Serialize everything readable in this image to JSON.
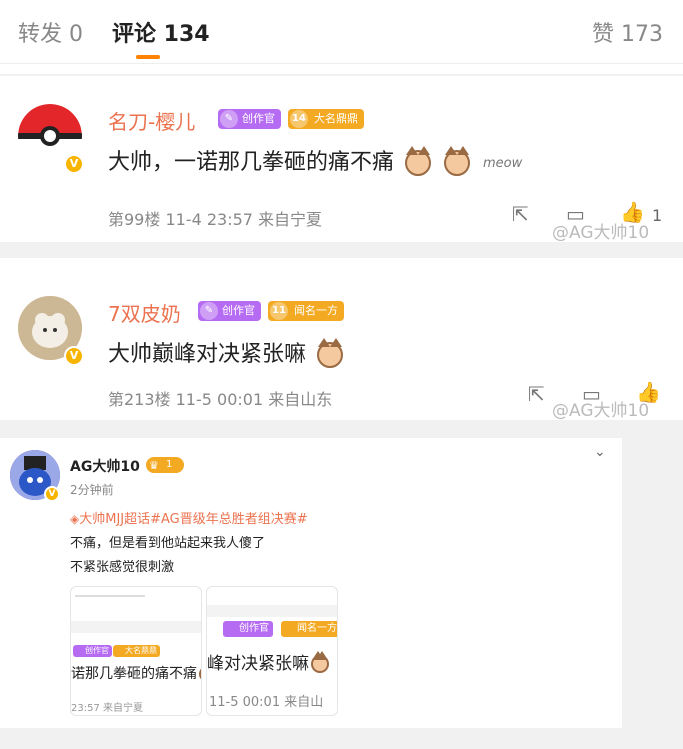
{
  "tabs": {
    "repost": "转发 0",
    "comment": "评论 134",
    "like": "赞 173"
  },
  "comment1": {
    "username": "名刀-樱儿",
    "chip_creator": "创作官",
    "chip_level": "14",
    "chip_title": "大名鼎鼎",
    "text": "大帅，一诺那几拳砸的痛不痛",
    "sticker": "meow",
    "meta": "第99楼 11-4 23:57 来自宁夏",
    "like_count": "1",
    "watermark": "@AG大帅10"
  },
  "comment2": {
    "username": "7双皮奶",
    "chip_creator": "创作官",
    "chip_level": "11",
    "chip_title": "闻名一方",
    "text": "大帅巅峰对决紧张嘛",
    "meta": "第213楼 11-5 00:01 来自山东",
    "watermark": "@AG大帅10"
  },
  "post": {
    "username": "AG大帅10",
    "level_badge": "1",
    "time": "2分钟前",
    "topics": "大帅MJJ超话#AG晋级年总胜者组决赛#",
    "line1": "不痛，但是看到他站起来我人傻了",
    "line2": "不紧张感觉很刺激",
    "thumb1": {
      "chip1": "创作官",
      "chip2": "大名鼎鼎",
      "text": "诺那几拳砸的痛不痛",
      "meta": "23:57  来自宁夏"
    },
    "thumb2": {
      "chip1": "创作官",
      "chip2": "闻名一方",
      "text": "峰对决紧张嘛",
      "meta": "11-5 00:01  来自山"
    }
  },
  "colors": {
    "accent": "#ff8200",
    "username": "#eb7350",
    "creator_chip": "#b66cf2",
    "level_chip_gold": "#f3a921",
    "level_chip_purple": "#a56ce8"
  }
}
